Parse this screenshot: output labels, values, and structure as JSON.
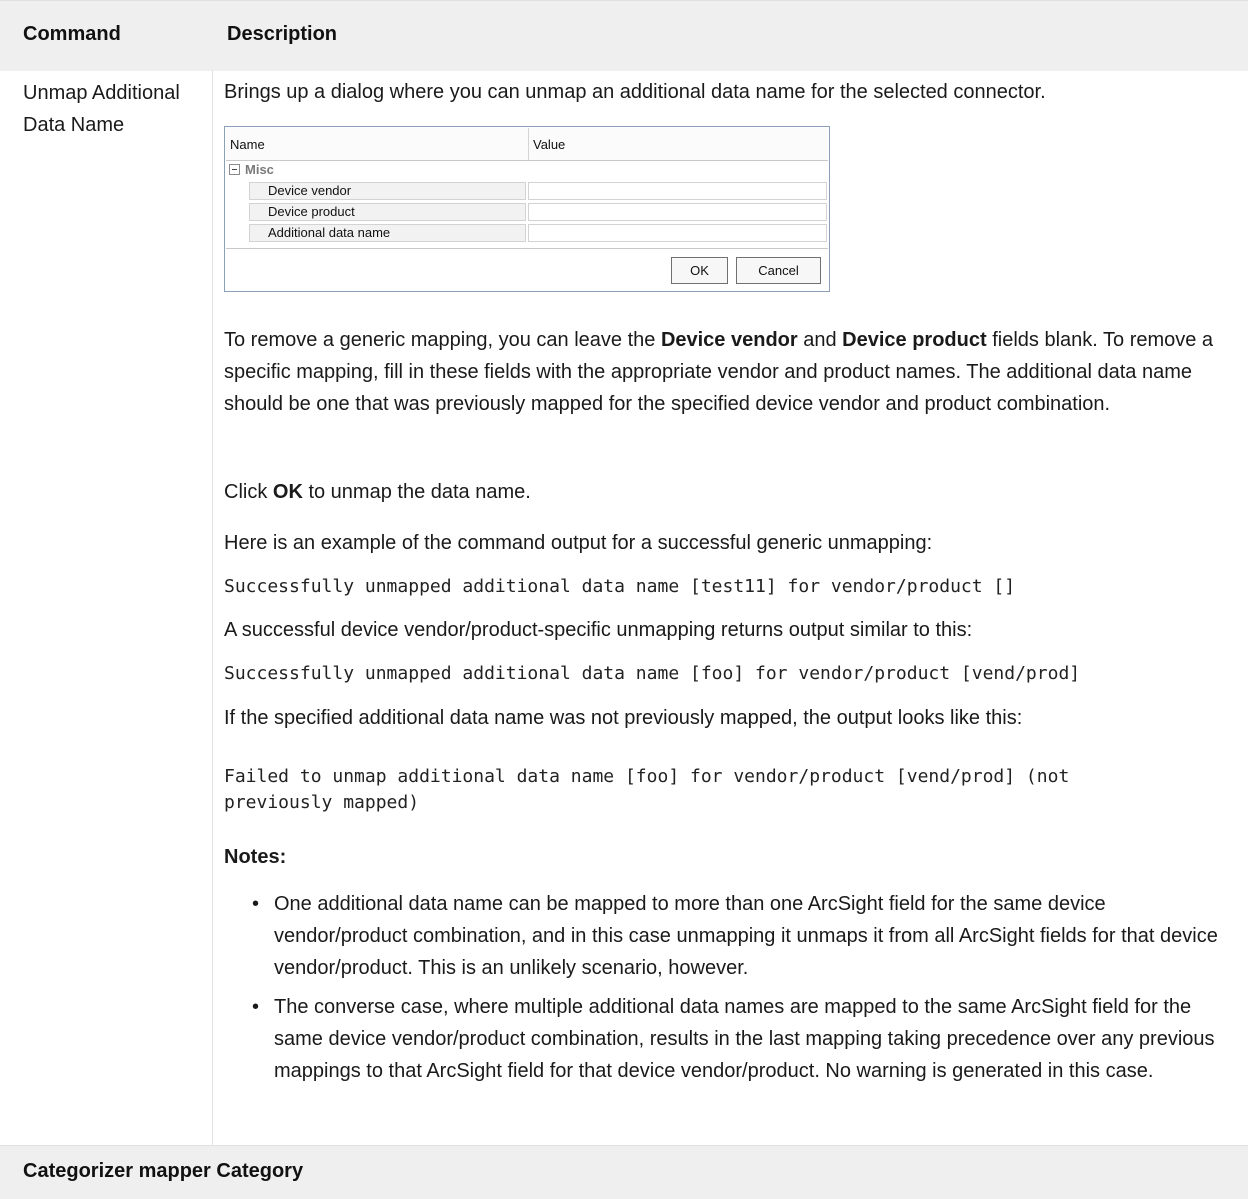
{
  "table": {
    "col_command": "Command",
    "col_description": "Description"
  },
  "command": "Unmap Additional Data Name",
  "intro": "Brings up a dialog where you can unmap an additional data name for the selected connector.",
  "dialog": {
    "col_name": "Name",
    "col_value": "Value",
    "category": "Misc",
    "rows": [
      "Device vendor",
      "Device product",
      "Additional data name"
    ],
    "ok": "OK",
    "cancel": "Cancel"
  },
  "para1": {
    "a": "To remove a generic mapping, you can leave the ",
    "b1": "Device vendor",
    "c": " and ",
    "b2": "Device product",
    "d": " fields blank. To remove a specific mapping, fill in these fields with the appropriate vendor and product names. The additional data name should be one that was previously mapped for the specified device vendor and product combination."
  },
  "para2": {
    "a": "Click ",
    "b": "OK",
    "c": " to unmap the data name."
  },
  "para3": "Here is an example of the command output for a successful generic unmapping:",
  "code1": "Successfully unmapped additional data name [test11] for vendor/product []",
  "para4": "A successful device vendor/product-specific unmapping returns output similar to this:",
  "code2": "Successfully unmapped additional data name [foo] for vendor/product [vend/prod]",
  "para5": "If the specified additional data name was not previously mapped, the output looks like this:",
  "code3": "Failed to unmap additional data name [foo] for vendor/product [vend/prod] (not\npreviously mapped)",
  "notes_label": "Notes:",
  "notes": [
    "One additional data name can be mapped to more than one ArcSight field for the same device vendor/product combination, and in this case unmapping it unmaps it from all ArcSight fields for that device vendor/product. This is an unlikely scenario, however.",
    "The converse case, where multiple additional data names are mapped to the same ArcSight field for the same device vendor/product combination, results in the last mapping taking precedence over any previous mappings to that ArcSight field for that device vendor/product. No warning is generated in this case."
  ],
  "footer": "Categorizer mapper Category"
}
